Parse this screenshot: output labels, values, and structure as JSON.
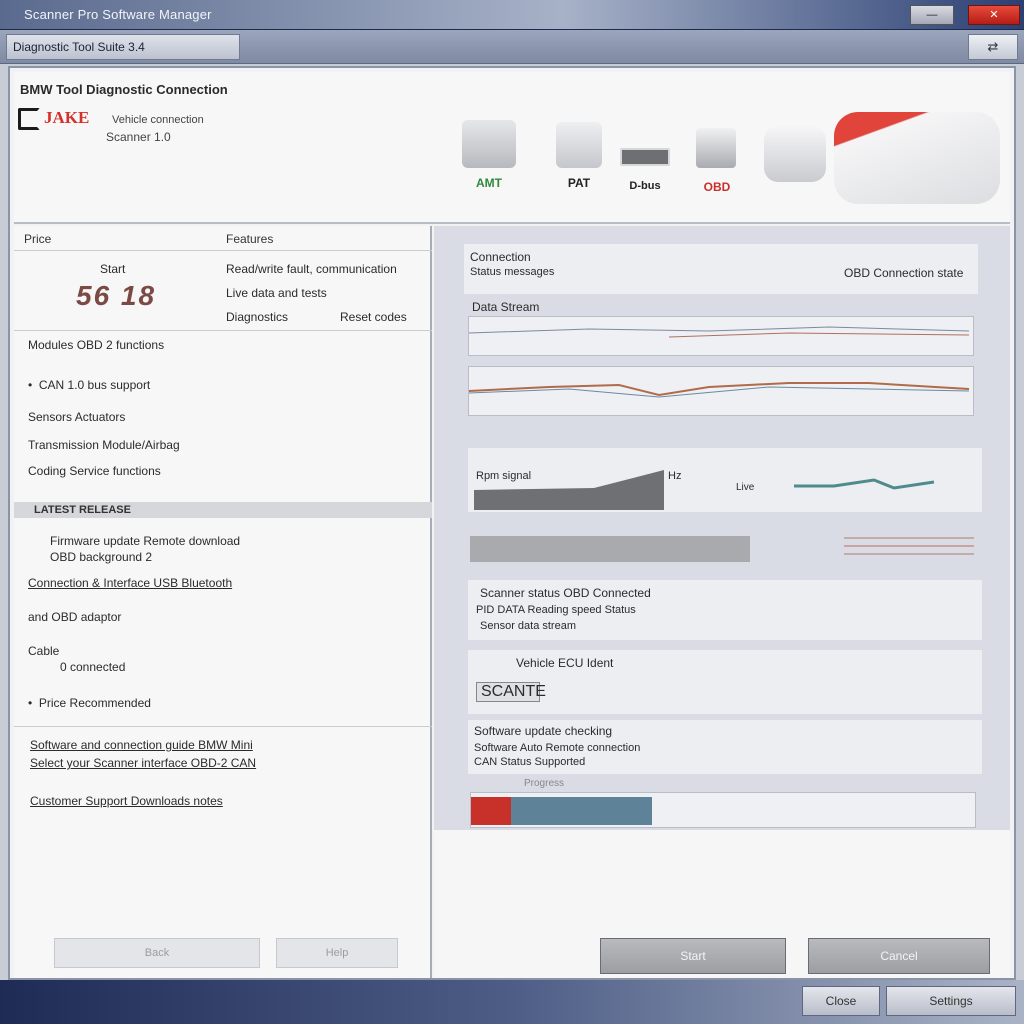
{
  "window": {
    "title": "Scanner Pro Software Manager",
    "minimize_label": "—",
    "close_label": "✕"
  },
  "toolbar": {
    "breadcrumb": "Diagnostic Tool Suite 3.4",
    "tool_label": "⇄"
  },
  "header": {
    "app_name": "BMW Tool Diagnostic Connection",
    "brand": "JAKE",
    "subtitle1": "Vehicle connection",
    "subtitle2": "Scanner 1.0",
    "devices": [
      {
        "label": "AMT",
        "color": "#2f8a3a"
      },
      {
        "label": "PAT",
        "color": "#222222"
      },
      {
        "label": "D-bus",
        "color": "#222222"
      },
      {
        "label": "OBD",
        "color": "#c8302a"
      }
    ]
  },
  "left": {
    "col1_header": "Price",
    "col2_header": "Features",
    "price_label": "Start",
    "price_value": "56 18",
    "features": [
      "Read/write fault, communication",
      "Live data and tests",
      "Diagnostics",
      "Reset codes"
    ],
    "summary_line": "Modules  OBD 2 functions",
    "bullet1": "CAN 1.0  bus support",
    "line_a": "Sensors    Actuators",
    "line_b": "Transmission  Module/Airbag",
    "line_c": "Coding  Service functions",
    "band_title": "LATEST RELEASE",
    "release_line1": "Firmware update  Remote download",
    "release_line2": "OBD  background 2",
    "link1": "Connection & Interface  USB  Bluetooth",
    "line_d": "and OBD adaptor",
    "line_e": "Cable",
    "line_f": "0 connected",
    "bullet2": "Price  Recommended",
    "link2": "Software and connection guide  BMW  Mini",
    "link3": "Select your  Scanner interface  OBD-2 CAN",
    "link4": "Customer  Support  Downloads  notes",
    "footer_btn1": "Back",
    "footer_btn2": "Help"
  },
  "right": {
    "panel_title": "Connection",
    "panel_sub": "Status messages",
    "panel_right": "OBD Connection state",
    "graph_label": "Data Stream",
    "graph2_label": "Rpm signal",
    "graph2_right": "Hz",
    "graph2_sub": "Live",
    "section1_title": "Scanner status  OBD  Connected",
    "section1_line1": "PID  DATA  Reading  speed  Status",
    "section1_line2": "Sensor  data  stream",
    "section2_title": "Vehicle  ECU  Ident",
    "section2_value": "SCANTE",
    "section3_title": "Software update checking",
    "section3_line1": "Software  Auto  Remote connection",
    "section3_line2": "CAN  Status  Supported",
    "progress_label": "Progress",
    "progress_value": 0.36,
    "btn_start": "Start",
    "btn_cancel": "Cancel"
  },
  "bottom": {
    "btn1": "Close",
    "btn2": "Settings"
  },
  "colors": {
    "accent_red": "#d6302a",
    "title_blue": "#2b3f73",
    "progress_red": "#c8302a",
    "progress_blue": "#5e8298"
  }
}
